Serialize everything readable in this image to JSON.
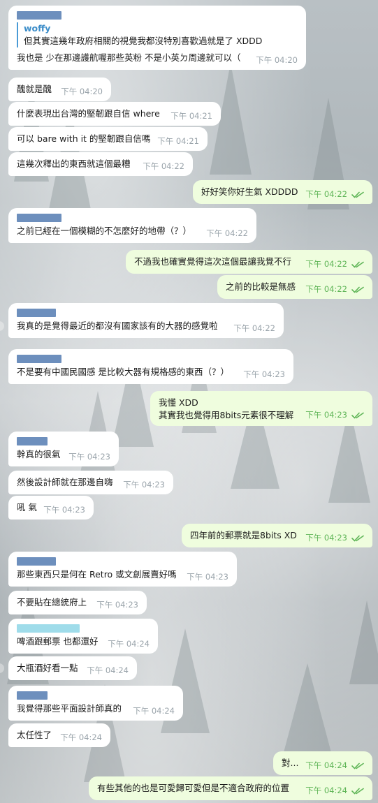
{
  "chat": {
    "messages": [
      {
        "id": "m1",
        "side": "in",
        "sender": true,
        "reply": {
          "name": "woffy",
          "text": "但其實這幾年政府相關的視覺我都沒特別喜歡過就是了 XDDD"
        },
        "lines": [
          "我也是 少在那邊護航喔那些英粉 不是小英ㄉ周邊就可以（"
        ],
        "time": "下午 04:20"
      },
      {
        "id": "m2",
        "side": "in",
        "lines": [
          "醜就是醜"
        ],
        "time": "下午 04:20"
      },
      {
        "id": "m3",
        "side": "in",
        "lines": [
          "什麼表現出台灣的堅韌跟自信 where"
        ],
        "time": "下午 04:21"
      },
      {
        "id": "m4",
        "side": "in",
        "lines": [
          "可以 bare with it 的堅韌跟自信嗎"
        ],
        "time": "下午 04:21"
      },
      {
        "id": "m5",
        "side": "in",
        "lines": [
          "這幾次釋出的東西就這個最糟"
        ],
        "time": "下午 04:22"
      },
      {
        "id": "m6",
        "side": "out",
        "lines": [
          "好好笑你好生氣 XDDDD"
        ],
        "time": "下午 04:22"
      },
      {
        "id": "m7",
        "side": "in",
        "sender": true,
        "lines": [
          "之前已經在一個模糊的不怎麼好的地帶（？）"
        ],
        "time": "下午 04:22"
      },
      {
        "id": "m8",
        "side": "out",
        "lines": [
          "不過我也確實覺得這次這個最讓我覺不行"
        ],
        "time": "下午 04:22"
      },
      {
        "id": "m9",
        "side": "out",
        "lines": [
          "之前的比較是無感"
        ],
        "time": "下午 04:22"
      },
      {
        "id": "m10",
        "side": "in",
        "sender": true,
        "lines": [
          "我真的是覺得最近的都沒有國家該有的大器的感覺啦"
        ],
        "time": "下午 04:22"
      },
      {
        "id": "m11",
        "side": "in",
        "sender": true,
        "lines": [
          "不是要有中國民國感 是比較大器有規格感的東西（？）"
        ],
        "time": "下午 04:23"
      },
      {
        "id": "m12",
        "side": "out",
        "lines": [
          "我懂 XDD",
          "其實我也覺得用8bits元素很不理解"
        ],
        "time": "下午 04:23"
      },
      {
        "id": "m13",
        "side": "in",
        "sender": true,
        "lines": [
          "幹真的很氣"
        ],
        "time": "下午 04:23"
      },
      {
        "id": "m14",
        "side": "in",
        "lines": [
          "然後設計師就在那邊自嗨"
        ],
        "time": "下午 04:23"
      },
      {
        "id": "m15",
        "side": "in",
        "lines": [
          "吼 氣"
        ],
        "time": "下午 04:23"
      },
      {
        "id": "m16",
        "side": "out",
        "lines": [
          "四年前的郵票就是8bits XD"
        ],
        "time": "下午 04:23"
      },
      {
        "id": "m17",
        "side": "in",
        "sender": true,
        "lines": [
          "那些東西只是何在 Retro 或文創展賣好嗎"
        ],
        "time": "下午 04:23"
      },
      {
        "id": "m18",
        "side": "in",
        "lines": [
          "不要貼在總統府上"
        ],
        "time": "下午 04:23"
      },
      {
        "id": "m19",
        "side": "in",
        "sender": true,
        "senderColor": "cyan",
        "lines": [
          "啤酒跟郵票 也都還好"
        ],
        "time": "下午 04:24"
      },
      {
        "id": "m20",
        "side": "in",
        "lines": [
          "大瓶酒好看一點"
        ],
        "time": "下午 04:24"
      },
      {
        "id": "m21",
        "side": "in",
        "sender": true,
        "lines": [
          "我覺得那些平面設計師真的"
        ],
        "time": "下午 04:24"
      },
      {
        "id": "m22",
        "side": "in",
        "lines": [
          "太任性了"
        ],
        "time": "下午 04:24"
      },
      {
        "id": "m23",
        "side": "out",
        "lines": [
          "對..."
        ],
        "time": "下午 04:24"
      },
      {
        "id": "m24",
        "side": "out",
        "lines": [
          "有些其他的也是可愛歸可愛但是不適合政府的位置"
        ],
        "time": "下午 04:24"
      }
    ]
  },
  "icons": {
    "read": "double-check-icon"
  },
  "colors": {
    "incoming_bg": "#ffffff",
    "outgoing_bg": "#effdde",
    "outgoing_time": "#5fb557",
    "reply_accent": "#4a9bd6",
    "sender_bar": "#6d8fbd"
  }
}
